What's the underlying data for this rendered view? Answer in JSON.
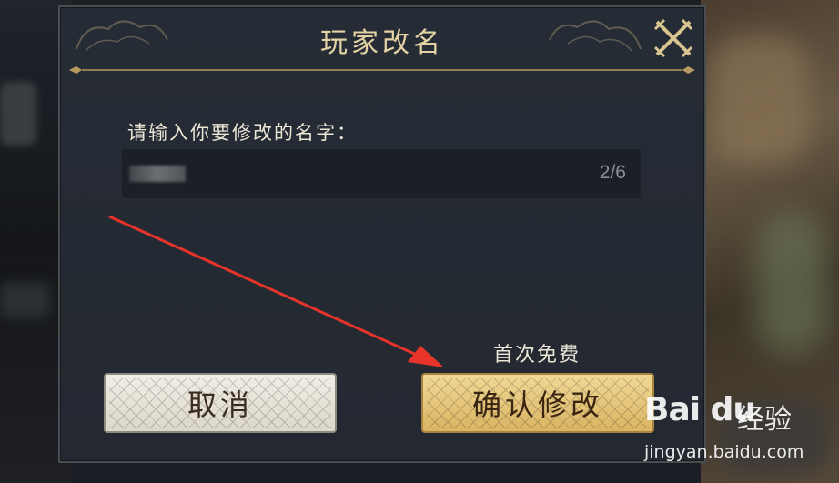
{
  "dialog": {
    "title": "玩家改名",
    "prompt": "请输入你要修改的名字：",
    "input": {
      "counter": "2/6"
    },
    "free_note": "首次免费",
    "cancel_label": "取消",
    "confirm_label": "确认修改"
  },
  "watermark": {
    "brand": "Bai du",
    "brand_cn": "经验",
    "url": "jingyan.baidu.com"
  },
  "annotation": {
    "arrow_color": "#e8342a"
  },
  "colors": {
    "title_gold": "#e3d2a3",
    "confirm_gold": "#e8c67a",
    "cancel_cream": "#e8e4d9",
    "panel_bg": "#252a33"
  }
}
